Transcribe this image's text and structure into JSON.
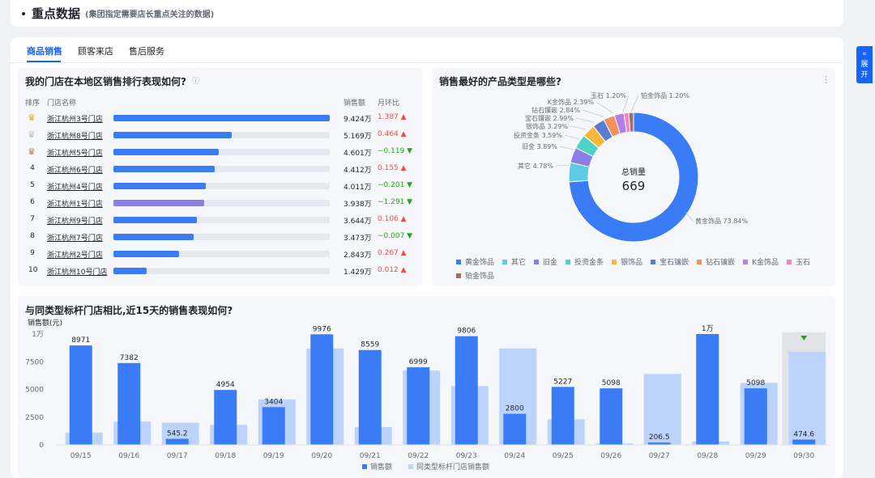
{
  "header": {
    "title": "重点数据",
    "subtitle": "(集团指定需要店长重点关注的数据)"
  },
  "tabs": [
    "商品销售",
    "顾客来店",
    "售后服务"
  ],
  "expand": {
    "icon": "«",
    "label_1": "展",
    "label_2": "开"
  },
  "ranking": {
    "title": "我的门店在本地区销售排行表现如何?",
    "col_rank": "排序",
    "col_store": "门店名称",
    "col_sales": "销售额",
    "col_mom": "月环比",
    "rows": [
      {
        "rank": "1",
        "store": "浙江杭州3号门店",
        "sales": "9.424万",
        "mom": "1.387",
        "dir": "up",
        "ratio": 1.0,
        "crown": "gold",
        "bar": "#3a7cf6"
      },
      {
        "rank": "2",
        "store": "浙江杭州8号门店",
        "sales": "5.169万",
        "mom": "0.464",
        "dir": "up",
        "ratio": 0.548,
        "crown": "silver",
        "bar": "#3a7cf6"
      },
      {
        "rank": "3",
        "store": "浙江杭州5号门店",
        "sales": "4.601万",
        "mom": "−0.119",
        "dir": "down",
        "ratio": 0.488,
        "crown": "bronze",
        "bar": "#3a7cf6"
      },
      {
        "rank": "4",
        "store": "浙江杭州6号门店",
        "sales": "4.412万",
        "mom": "0.155",
        "dir": "up",
        "ratio": 0.468,
        "crown": "",
        "bar": "#3a7cf6"
      },
      {
        "rank": "5",
        "store": "浙江杭州4号门店",
        "sales": "4.011万",
        "mom": "−0.201",
        "dir": "down",
        "ratio": 0.426,
        "crown": "",
        "bar": "#3a7cf6"
      },
      {
        "rank": "6",
        "store": "浙江杭州1号门店",
        "sales": "3.938万",
        "mom": "−1.291",
        "dir": "down",
        "ratio": 0.418,
        "crown": "",
        "bar": "#8b7fe6"
      },
      {
        "rank": "7",
        "store": "浙江杭州9号门店",
        "sales": "3.644万",
        "mom": "0.106",
        "dir": "up",
        "ratio": 0.387,
        "crown": "",
        "bar": "#3a7cf6"
      },
      {
        "rank": "8",
        "store": "浙江杭州7号门店",
        "sales": "3.473万",
        "mom": "−0.007",
        "dir": "down",
        "ratio": 0.369,
        "crown": "",
        "bar": "#3a7cf6"
      },
      {
        "rank": "9",
        "store": "浙江杭州2号门店",
        "sales": "2.843万",
        "mom": "0.267",
        "dir": "up",
        "ratio": 0.302,
        "crown": "",
        "bar": "#3a7cf6"
      },
      {
        "rank": "10",
        "store": "浙江杭州10号门店",
        "sales": "1.429万",
        "mom": "0.012",
        "dir": "up",
        "ratio": 0.152,
        "crown": "",
        "bar": "#3a7cf6"
      }
    ],
    "colors": {
      "up": "#f54a45",
      "down": "#2ea121"
    }
  },
  "donut": {
    "title": "销售最好的产品类型是哪些?",
    "center_label": "总销量",
    "center_value": "669"
  },
  "trend": {
    "title": "与同类型标杆门店相比,近15天的销售表现如何?"
  },
  "chart_data": [
    {
      "type": "pie",
      "title": "销售最好的产品类型是哪些?",
      "categories": [
        "黄金饰品",
        "其它",
        "旧金",
        "投资金条",
        "银饰品",
        "宝石镶嵌",
        "钻石镶嵌",
        "K金饰品",
        "玉石",
        "铂金饰品"
      ],
      "values": [
        73.84,
        4.78,
        3.89,
        3.59,
        3.29,
        2.99,
        2.84,
        2.39,
        1.2,
        1.2
      ],
      "labels": [
        "黄金饰品 73.84%",
        "其它 4.78%",
        "旧金 3.89%",
        "投资金条 3.59%",
        "银饰品 3.29%",
        "宝石镶嵌 2.99%",
        "钻石镶嵌 2.84%",
        "K金饰品 2.39%",
        "玉石 1.20%",
        "铂金饰品 1.20%"
      ],
      "colors": [
        "#3a7cf6",
        "#5ccbe8",
        "#8b7fe6",
        "#4fd1c5",
        "#f7b83c",
        "#5b7bd5",
        "#f0905a",
        "#b37feb",
        "#f285c1",
        "#a1706a"
      ],
      "legend": "bottom"
    },
    {
      "type": "bar",
      "title": "与同类型标杆门店相比,近15天的销售表现如何?",
      "ylabel": "销售额(元)",
      "ylim": [
        0,
        10000
      ],
      "yticks": [
        "0",
        "2500",
        "5000",
        "7500",
        "1万"
      ],
      "categories": [
        "09/15",
        "09/16",
        "09/17",
        "09/18",
        "09/19",
        "09/20",
        "09/21",
        "09/22",
        "09/23",
        "09/24",
        "09/25",
        "09/26",
        "09/27",
        "09/28",
        "09/29",
        "09/30"
      ],
      "series": [
        {
          "name": "销售额",
          "color": "#3a7cf6",
          "values": [
            8971,
            7382,
            545.2,
            4954,
            3404,
            9976,
            8559,
            6999,
            9806,
            2800,
            5227,
            5098,
            206.5,
            10000,
            5098,
            474.6
          ],
          "labels": [
            "8971",
            "7382",
            "545.2",
            "4954",
            "3404",
            "9976",
            "8559",
            "6999",
            "9806",
            "2800",
            "5227",
            "5098",
            "206.5",
            "1万",
            "5098",
            "474.6"
          ]
        },
        {
          "name": "同类型标杆门店销售额",
          "color": "#bcd3fb",
          "values": [
            1100,
            2100,
            2000,
            1800,
            4100,
            8700,
            1600,
            6700,
            5300,
            8700,
            2300,
            120,
            6400,
            300,
            5600,
            8400
          ]
        }
      ],
      "legend": "bottom"
    }
  ]
}
